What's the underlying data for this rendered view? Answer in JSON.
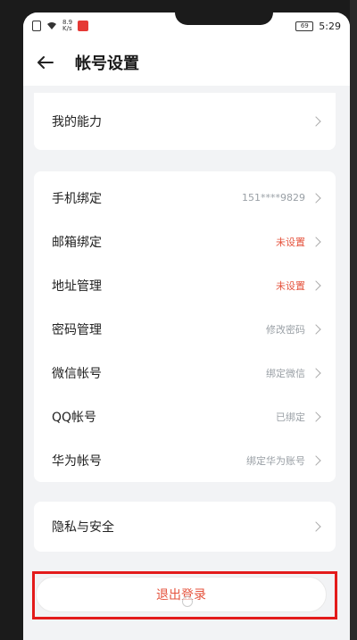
{
  "status_bar": {
    "speed_top": "8.9",
    "speed_bottom": "K/s",
    "battery": "69",
    "time": "5:29"
  },
  "header": {
    "title": "帐号设置",
    "back_icon": "arrow-left-icon"
  },
  "top_card": {
    "label": "我的能力"
  },
  "bindings": [
    {
      "label": "手机绑定",
      "value": "151****9829",
      "warn": false
    },
    {
      "label": "邮箱绑定",
      "value": "未设置",
      "warn": true
    },
    {
      "label": "地址管理",
      "value": "未设置",
      "warn": true
    },
    {
      "label": "密码管理",
      "value": "修改密码",
      "warn": false
    },
    {
      "label": "微信帐号",
      "value": "绑定微信",
      "warn": false
    },
    {
      "label": "QQ帐号",
      "value": "已绑定",
      "warn": false
    },
    {
      "label": "华为帐号",
      "value": "绑定华为账号",
      "warn": false
    }
  ],
  "privacy": {
    "label": "隐私与安全"
  },
  "logout": {
    "label": "退出登录"
  },
  "colors": {
    "warn": "#e5533d",
    "highlight": "#e31b1b",
    "background": "#f2f3f5"
  }
}
